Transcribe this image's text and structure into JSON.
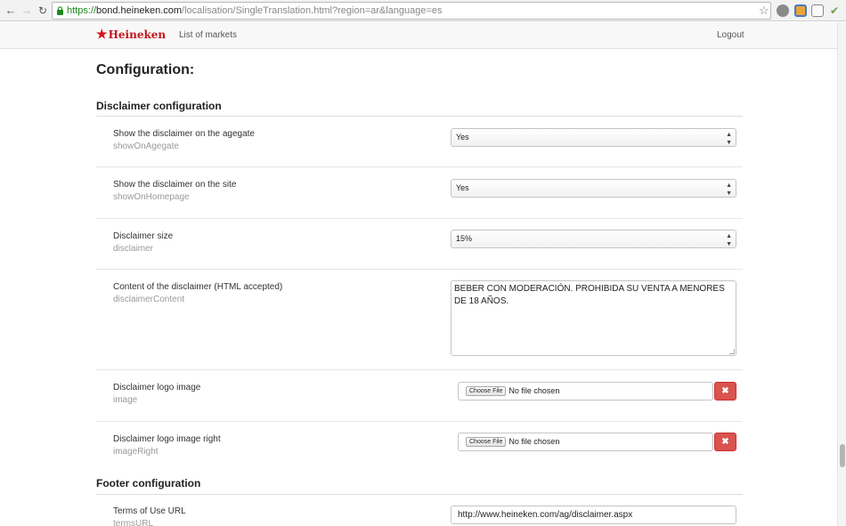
{
  "browser": {
    "url_scheme": "https://",
    "url_host": "bond.heineken.com",
    "url_path": "/localisation/SingleTranslation.html?region=ar&language=es"
  },
  "header": {
    "logo_text": "Heineken",
    "nav_markets": "List of markets",
    "logout": "Logout"
  },
  "page": {
    "title": "Configuration:"
  },
  "sections": {
    "disclaimer": "Disclaimer configuration",
    "footer": "Footer configuration"
  },
  "rows": [
    {
      "label": "Show the disclaimer on the agegate",
      "key": "showOnAgegate",
      "value": "Yes"
    },
    {
      "label": "Show the disclaimer on the site",
      "key": "showOnHomepage",
      "value": "Yes"
    },
    {
      "label": "Disclaimer size",
      "key": "disclaimer",
      "value": "15%"
    },
    {
      "label": "Content of the disclaimer (HTML accepted)",
      "key": "disclaimerContent",
      "value": "BEBER CON MODERACIÓN. PROHIBIDA SU VENTA A MENORES DE 18 AÑOS."
    },
    {
      "label": "Disclaimer logo image",
      "key": "image",
      "choose_label": "Choose File",
      "file_status": "No file chosen"
    },
    {
      "label": "Disclaimer logo image right",
      "key": "imageRight",
      "choose_label": "Choose File",
      "file_status": "No file chosen"
    },
    {
      "label": "Terms of Use URL",
      "key": "termsURL",
      "value": "http://www.heineken.com/ag/disclaimer.aspx"
    }
  ],
  "glyphs": {
    "back": "←",
    "forward": "→",
    "reload": "↻",
    "star": "☆",
    "select_up": "▲",
    "select_down": "▼",
    "remove": "✖",
    "brand_star": "★",
    "check": "✔"
  },
  "colors": {
    "brand_red": "#c5161d",
    "danger": "#d9534f",
    "url_green": "#1d8a1d"
  }
}
